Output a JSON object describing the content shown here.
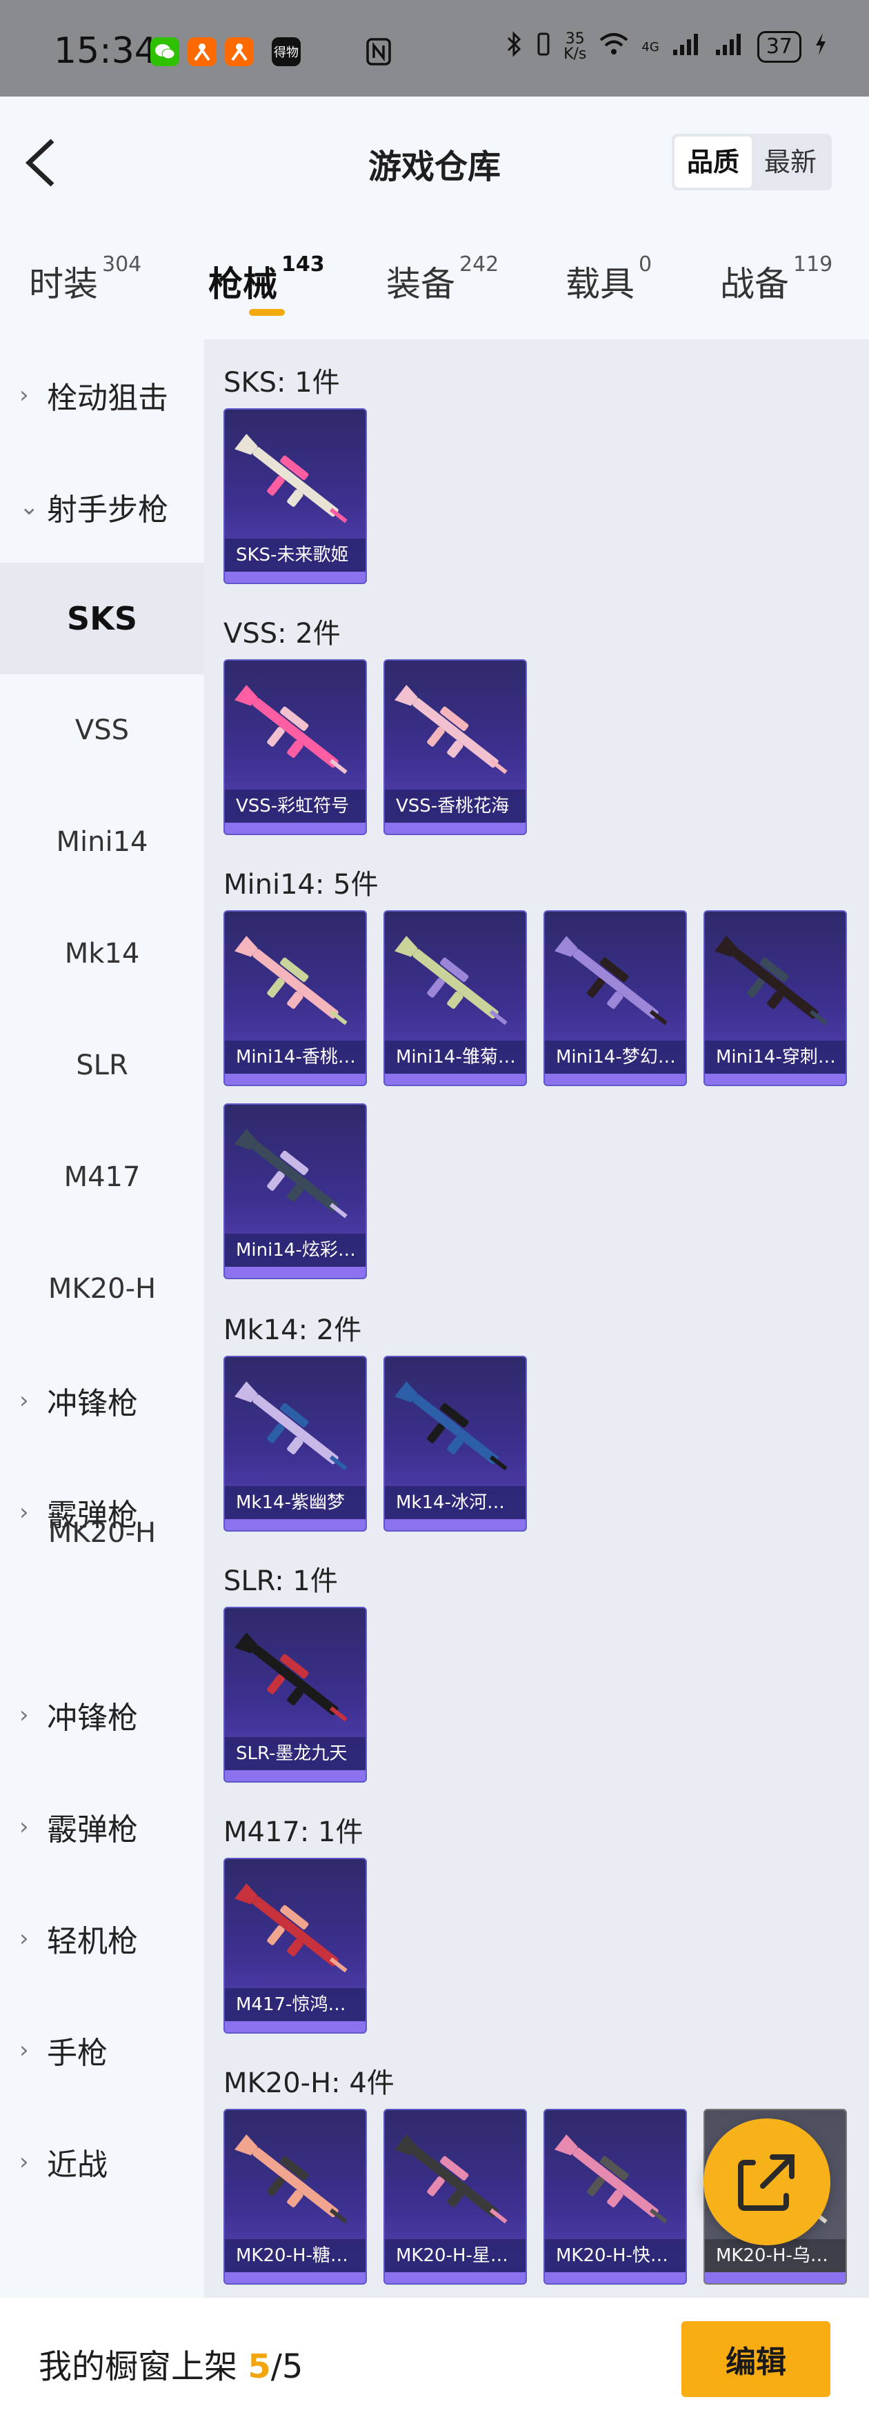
{
  "status_bar": {
    "time": "15:34",
    "app_icons": [
      "wechat-icon",
      "app-icon",
      "app-icon",
      "dewu-icon"
    ],
    "dewu_label": "得物",
    "net_speed_value": "35",
    "net_speed_unit": "K/s",
    "network_label": "4G",
    "battery": "37"
  },
  "header": {
    "title": "游戏仓库",
    "sort_options": [
      "品质",
      "最新"
    ],
    "sort_active": "品质"
  },
  "tabs": [
    {
      "label": "时装",
      "count": "304"
    },
    {
      "label": "枪械",
      "count": "143",
      "active": true
    },
    {
      "label": "装备",
      "count": "242"
    },
    {
      "label": "载具",
      "count": "0"
    },
    {
      "label": "战备",
      "count": "119"
    }
  ],
  "sidebar": {
    "items": [
      {
        "label": "栓动狙击",
        "type": "group",
        "icon": "chevron-right-icon"
      },
      {
        "label": "射手步枪",
        "type": "group",
        "icon": "chevron-down-icon"
      },
      {
        "label": "SKS",
        "type": "sub",
        "active": true
      },
      {
        "label": "VSS",
        "type": "sub"
      },
      {
        "label": "Mini14",
        "type": "sub"
      },
      {
        "label": "Mk14",
        "type": "sub"
      },
      {
        "label": "SLR",
        "type": "sub"
      },
      {
        "label": "M417",
        "type": "sub"
      },
      {
        "label": "MK20-H",
        "type": "sub"
      },
      {
        "label": "冲锋枪",
        "type": "group",
        "icon": "chevron-right-icon"
      },
      {
        "label": "霰弹枪",
        "type": "group",
        "icon": "chevron-right-icon"
      },
      {
        "label": "MK20-H",
        "type": "sub"
      },
      {
        "label": "冲锋枪",
        "type": "group",
        "icon": "chevron-right-icon"
      },
      {
        "label": "霰弹枪",
        "type": "group",
        "icon": "chevron-right-icon"
      },
      {
        "label": "轻机枪",
        "type": "group",
        "icon": "chevron-right-icon"
      },
      {
        "label": "手枪",
        "type": "group",
        "icon": "chevron-right-icon"
      },
      {
        "label": "近战",
        "type": "group",
        "icon": "chevron-right-icon"
      }
    ]
  },
  "sections": [
    {
      "label": "SKS: 1件",
      "items": [
        "SKS-未来歌姬"
      ]
    },
    {
      "label": "VSS: 2件",
      "items": [
        "VSS-彩虹符号",
        "VSS-香桃花海"
      ]
    },
    {
      "label": "Mini14: 5件",
      "items": [
        "Mini14-香桃…",
        "Mini14-雏菊…",
        "Mini14-梦幻…",
        "Mini14-穿刺…",
        "Mini14-炫彩…"
      ]
    },
    {
      "label": "Mk14: 2件",
      "items": [
        "Mk14-紫幽梦",
        "Mk14-冰河…"
      ]
    },
    {
      "label": "SLR: 1件",
      "items": [
        "SLR-墨龙九天"
      ]
    },
    {
      "label": "M417: 1件",
      "items": [
        "M417-惊鸿…"
      ]
    },
    {
      "label": "MK20-H: 4件",
      "items": [
        "MK20-H-糖…",
        "MK20-H-星…",
        "MK20-H-快…",
        "MK20-H-乌…"
      ]
    }
  ],
  "gun_colors": [
    "#e9e3d6",
    "#ff5fa2",
    "#f2c1cf",
    "#f5b5bd",
    "#c9d39a",
    "#9b86d8",
    "#2a1e1e",
    "#3a4a5a",
    "#c8b8e8",
    "#2c5fa8",
    "#1a1a1a",
    "#c8323c",
    "#f1a58f",
    "#3a3a3a",
    "#e78ab0",
    "#555555"
  ],
  "bottom_bar": {
    "label": "我的橱窗上架",
    "current": "5",
    "sep_total": "/5",
    "edit_label": "编辑"
  },
  "fab_icon": "share-external-icon"
}
